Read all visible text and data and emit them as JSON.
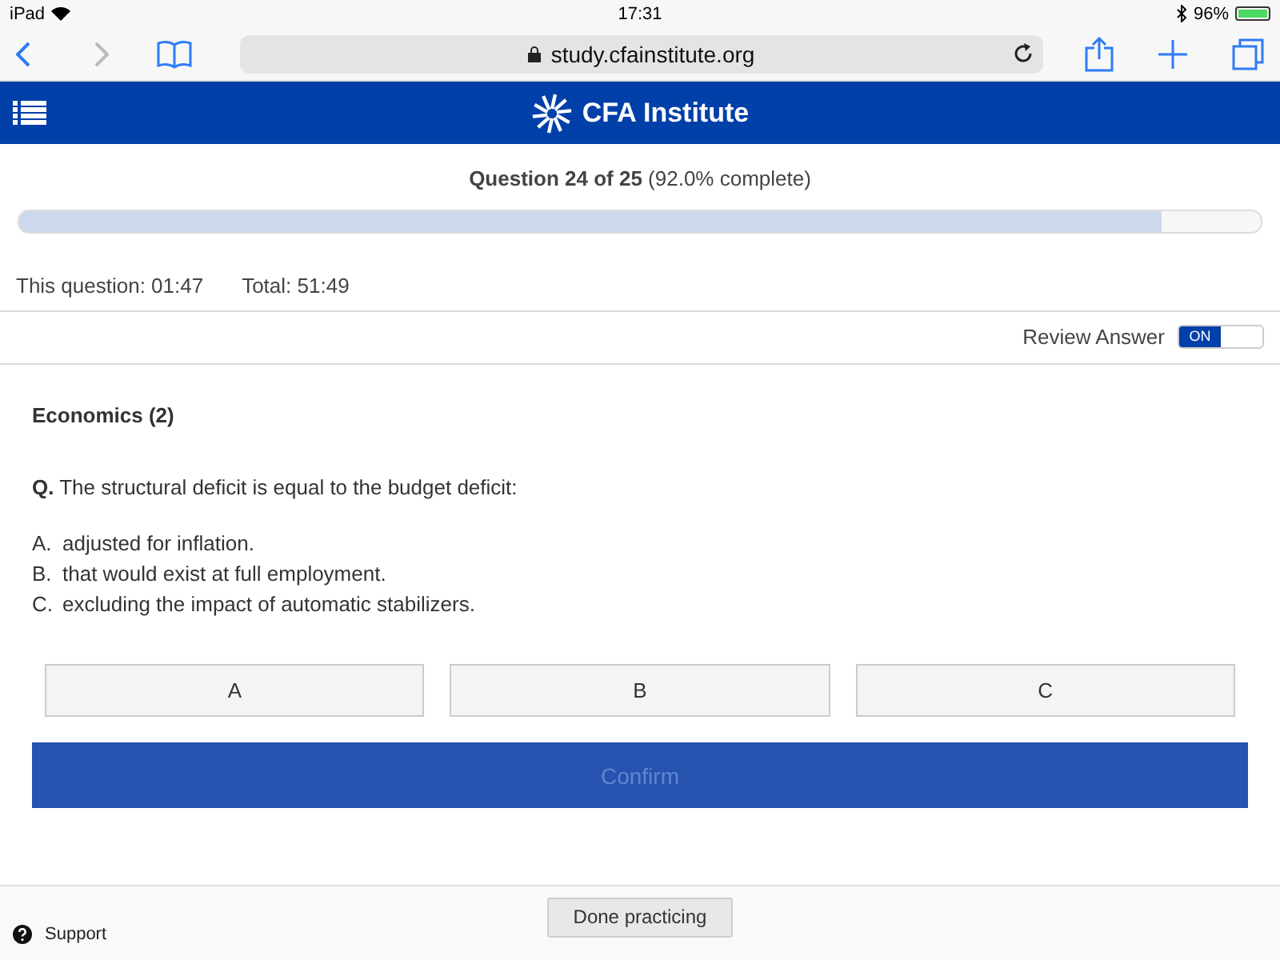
{
  "status_bar": {
    "device": "iPad",
    "time": "17:31",
    "battery": "96%"
  },
  "browser": {
    "url": "study.cfainstitute.org"
  },
  "header": {
    "title": "CFA Institute"
  },
  "progress": {
    "heading": "**Question 24 of 25** (92.0% complete)",
    "level": 0.92
  },
  "timers": [
    "This question: 01:47",
    "Total: 51:49"
  ],
  "review": {
    "label": "Review Answer",
    "toggle": "ON",
    "on": true
  },
  "question": {
    "topic": "Economics (2)",
    "text": "**Q.** The structural deficit is equal to the budget deficit:",
    "options": [
      {
        "letter": "A.",
        "text": "adjusted for inflation."
      },
      {
        "letter": "B.",
        "text": "that would exist at full employment."
      },
      {
        "letter": "C.",
        "text": "excluding the impact of automatic stabilizers."
      }
    ]
  },
  "answer_buttons": [
    {
      "label": "A",
      "selected": false
    },
    {
      "label": "B",
      "selected": false
    },
    {
      "label": "C",
      "selected": false
    }
  ],
  "confirm": {
    "label": "Confirm",
    "disabled": true
  },
  "footer": {
    "support": "Support",
    "done": "Done practicing"
  }
}
